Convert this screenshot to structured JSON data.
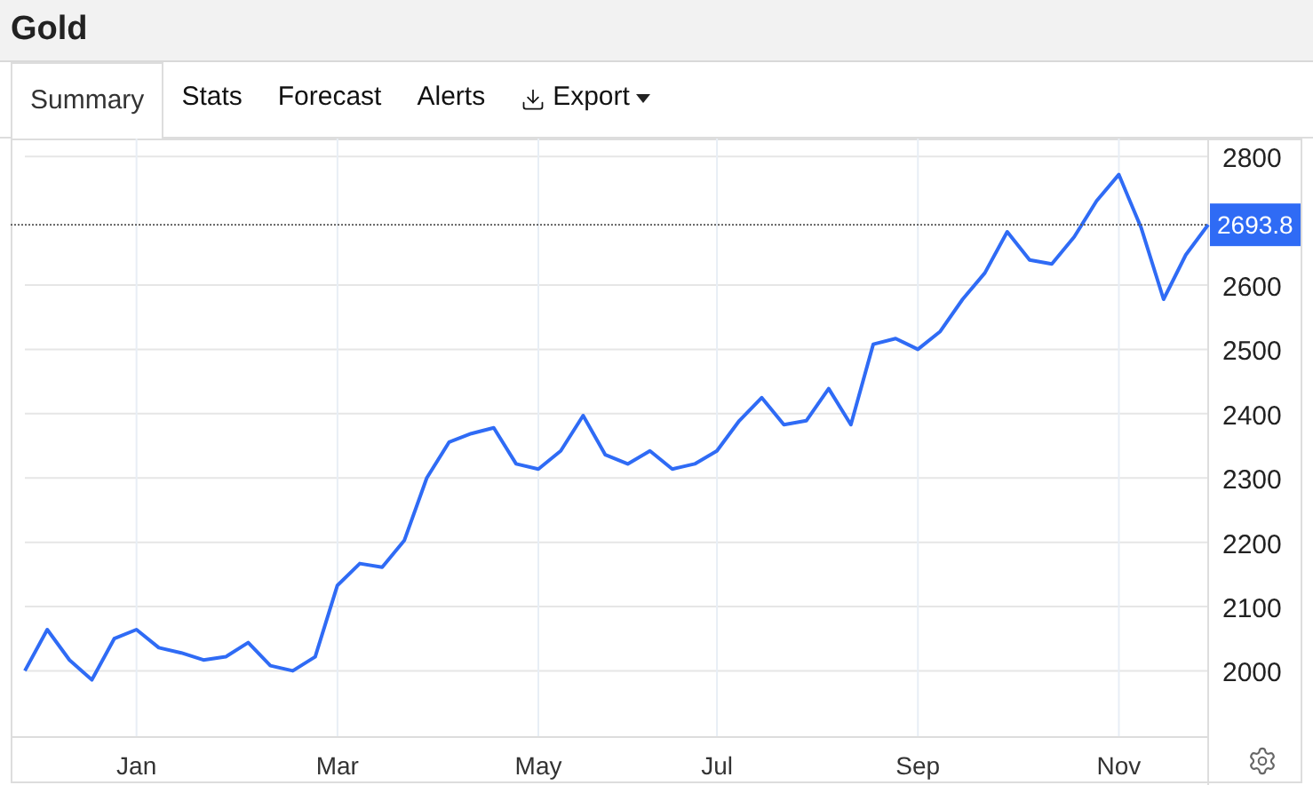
{
  "title": "Gold",
  "tabs": [
    {
      "label": "Summary",
      "selected": true,
      "kind": "tab"
    },
    {
      "label": "Stats",
      "selected": false,
      "kind": "tab"
    },
    {
      "label": "Forecast",
      "selected": false,
      "kind": "tab"
    },
    {
      "label": "Alerts",
      "selected": false,
      "kind": "tab"
    },
    {
      "label": "Export",
      "selected": false,
      "kind": "menu"
    }
  ],
  "chart": {
    "chart_data": {
      "type": "line",
      "grid": true,
      "categories": [
        null,
        null,
        null,
        null,
        null,
        "Jan",
        null,
        null,
        null,
        null,
        null,
        null,
        null,
        null,
        "Mar",
        null,
        null,
        null,
        null,
        null,
        null,
        null,
        null,
        "May",
        null,
        null,
        null,
        null,
        null,
        null,
        null,
        "Jul",
        null,
        null,
        null,
        null,
        null,
        null,
        null,
        null,
        "Sep",
        null,
        null,
        null,
        null,
        null,
        null,
        null,
        null,
        "Nov",
        null,
        null,
        null,
        null
      ],
      "ylim": [
        1897,
        2828
      ],
      "yticks": [
        2000,
        2100,
        2200,
        2300,
        2400,
        2500,
        2600,
        2800
      ],
      "ref_lines": [
        {
          "axis": "y",
          "value": 2693.8,
          "label": "2693.8",
          "color": "#555555"
        }
      ],
      "series": [
        {
          "color": "#2f6bf5",
          "values": [
            2000,
            2064,
            2017,
            1986,
            2050,
            2064,
            2036,
            2028,
            2017,
            2022,
            2044,
            2008,
            2000,
            2022,
            2133,
            2167,
            2161,
            2203,
            2300,
            2356,
            2369,
            2378,
            2322,
            2314,
            2342,
            2397,
            2336,
            2322,
            2342,
            2314,
            2322,
            2342,
            2389,
            2425,
            2383,
            2389,
            2439,
            2383,
            2508,
            2517,
            2500,
            2528,
            2578,
            2619,
            2683,
            2639,
            2633,
            2675,
            2731,
            2772,
            2689,
            2578,
            2647,
            2694
          ]
        }
      ]
    }
  }
}
